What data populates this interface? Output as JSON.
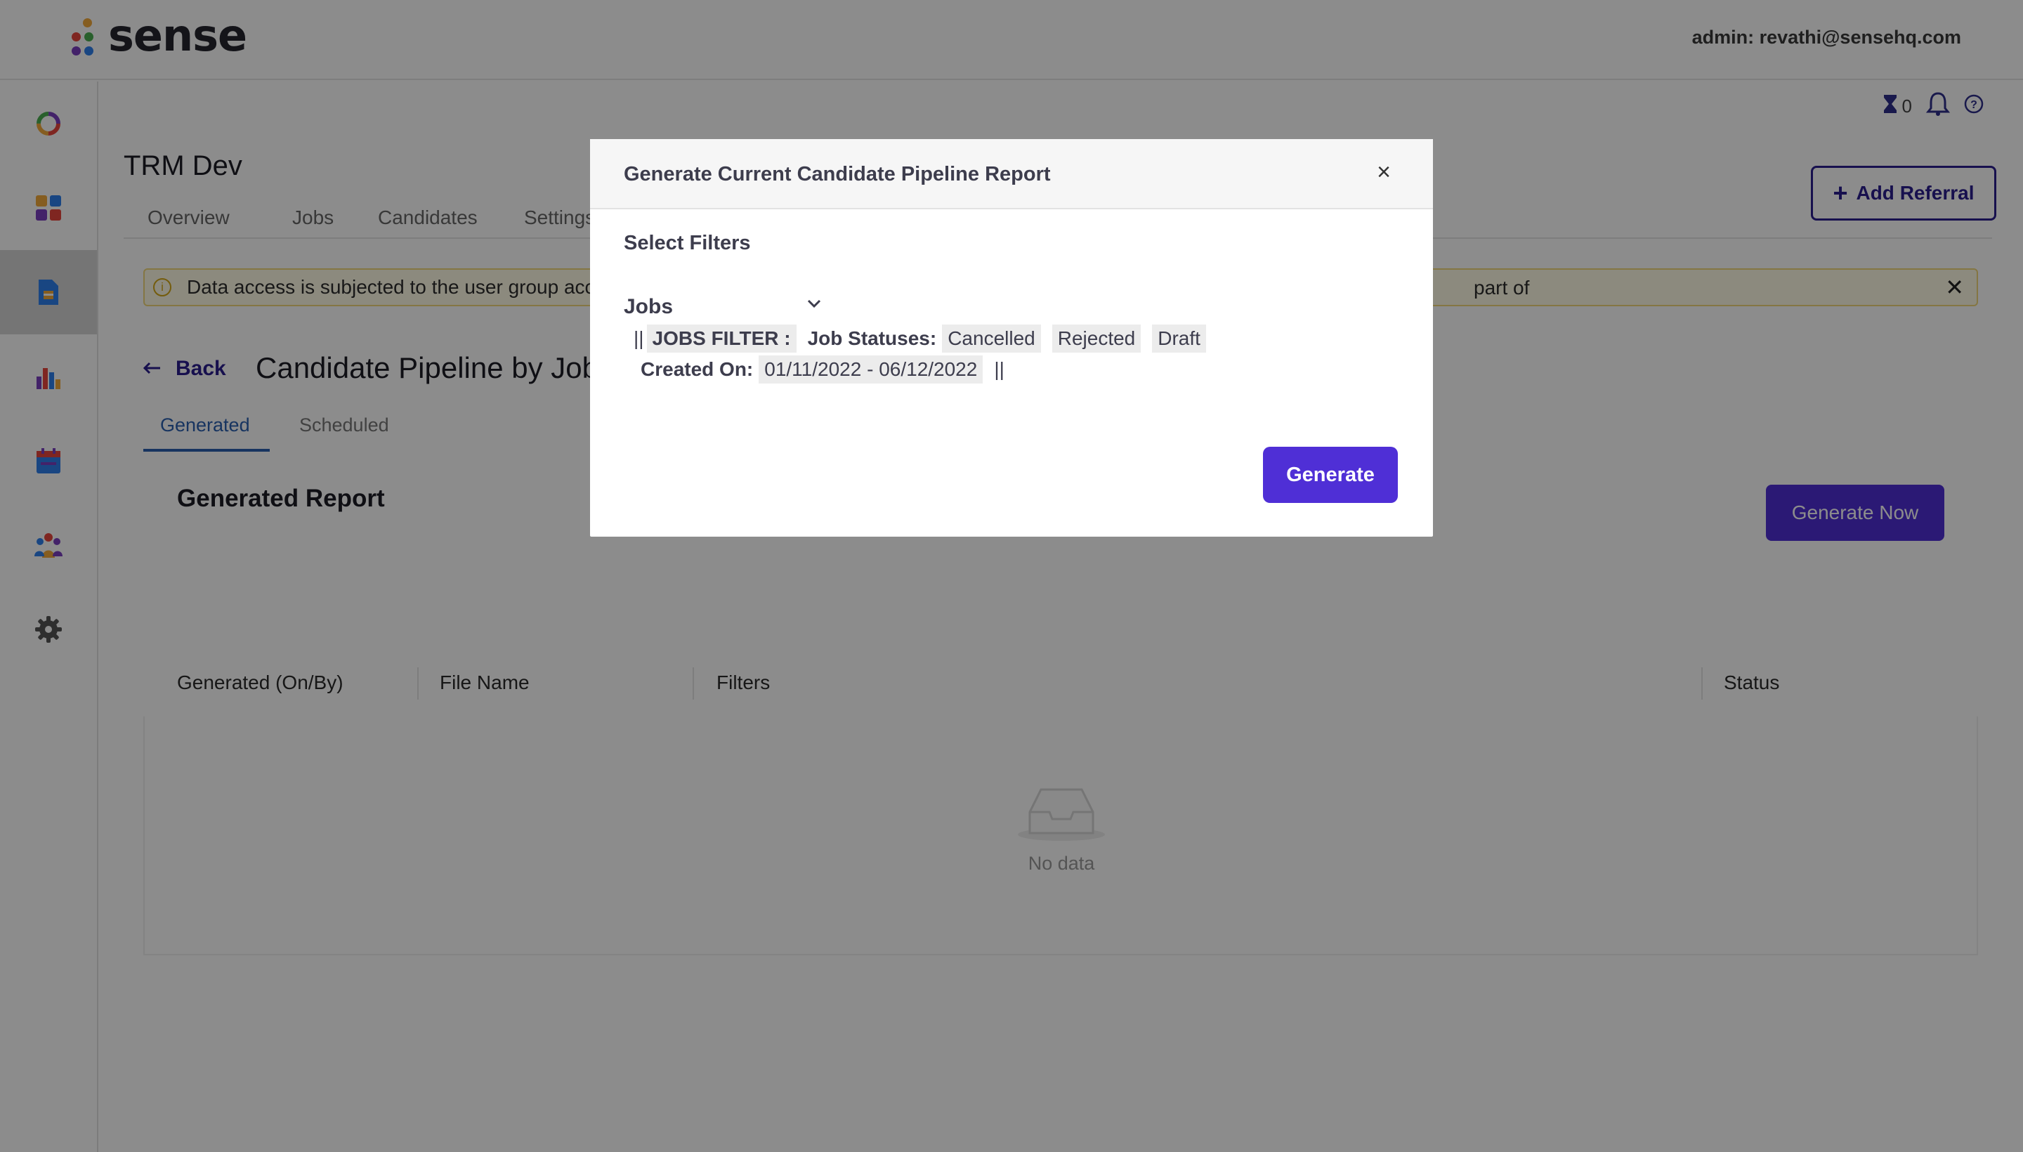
{
  "header": {
    "logo_text": "sense",
    "user_label": "admin: revathi@sensehq.com",
    "dot_colors": [
      "#e7463c",
      "#f2a93b",
      "#4caf50",
      "#2f80ed",
      "#7b3fbf"
    ]
  },
  "sidebar": {
    "items": [
      {
        "icon": "activity-ring-icon"
      },
      {
        "icon": "dashboard-grid-icon"
      },
      {
        "icon": "reports-document-icon",
        "active": true
      },
      {
        "icon": "analytics-bar-chart-icon"
      },
      {
        "icon": "calendar-icon"
      },
      {
        "icon": "team-people-icon"
      },
      {
        "icon": "settings-gear-icon"
      }
    ]
  },
  "utility": {
    "pending_count": "0"
  },
  "project": {
    "title": "TRM Dev",
    "tabs": [
      "Overview",
      "Jobs",
      "Candidates",
      "Settings"
    ],
    "add_referral_label": "Add Referral"
  },
  "alert": {
    "message_start": "Data access is subjected to the user group acc",
    "message_end": "part of"
  },
  "report_page": {
    "back_label": "Back",
    "heading": "Candidate Pipeline by Job",
    "tabs": [
      "Generated",
      "Scheduled"
    ],
    "section_title": "Generated Report",
    "generate_now_label": "Generate Now",
    "columns": [
      "Generated (On/By)",
      "File Name",
      "Filters",
      "Status"
    ],
    "empty_text": "No data"
  },
  "modal": {
    "title": "Generate Current Candidate Pipeline Report",
    "close_symbol": "×",
    "filters_label": "Select Filters",
    "select_value": "Jobs",
    "pipe": "||",
    "jobs_filter_label": "JOBS FILTER :",
    "job_statuses_label": "Job Statuses:",
    "statuses": [
      "Cancelled",
      "Rejected",
      "Draft"
    ],
    "created_on_label": "Created On:",
    "created_on_value": "01/11/2022 - 06/12/2022",
    "generate_label": "Generate"
  },
  "colors": {
    "primary": "#4f2fd6",
    "link": "#2b1e8f",
    "tab_active": "#2a5fb0",
    "alert_bg": "#fffbe6"
  }
}
